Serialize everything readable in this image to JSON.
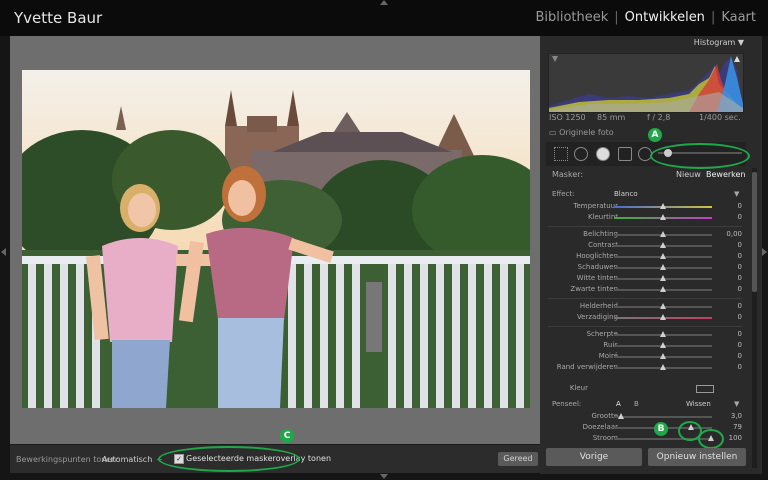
{
  "header": {
    "identity": "Yvette Baur",
    "modules": [
      {
        "label": "Bibliotheek",
        "active": false
      },
      {
        "label": "Ontwikkelen",
        "active": true
      },
      {
        "label": "Kaart",
        "active": false
      }
    ],
    "separator": "|"
  },
  "histogram": {
    "title": "Histogram",
    "iso": "ISO 1250",
    "focal": "85 mm",
    "aperture": "f / 2,8",
    "shutter": "1/400 sec.",
    "original_label": "Originele foto"
  },
  "mask": {
    "label": "Masker:",
    "new_label": "Nieuw",
    "edit_label": "Bewerken"
  },
  "effect": {
    "label": "Effect:",
    "value": "Blanco"
  },
  "adjustments": [
    {
      "label": "Temperatuur",
      "value": "0",
      "pos": 0.5
    },
    {
      "label": "Kleurtint",
      "value": "0",
      "pos": 0.5
    },
    {
      "label": "Belichting",
      "value": "0,00",
      "pos": 0.5
    },
    {
      "label": "Contrast",
      "value": "0",
      "pos": 0.5
    },
    {
      "label": "Hooglichten",
      "value": "0",
      "pos": 0.5
    },
    {
      "label": "Schaduwen",
      "value": "0",
      "pos": 0.5
    },
    {
      "label": "Witte tinten",
      "value": "0",
      "pos": 0.5
    },
    {
      "label": "Zwarte tinten",
      "value": "0",
      "pos": 0.5
    },
    {
      "label": "Helderheid",
      "value": "0",
      "pos": 0.5
    },
    {
      "label": "Verzadiging",
      "value": "0",
      "pos": 0.5
    },
    {
      "label": "Scherpte",
      "value": "0",
      "pos": 0.5
    },
    {
      "label": "Ruis",
      "value": "0",
      "pos": 0.5
    },
    {
      "label": "Moiré",
      "value": "0",
      "pos": 0.5
    },
    {
      "label": "Rand verwijderen",
      "value": "0",
      "pos": 0.5
    }
  ],
  "color_label": "Kleur",
  "brush": {
    "label": "Penseel:",
    "a": "A",
    "b": "B",
    "clear": "Wissen",
    "size_label": "Grootte",
    "size_value": "3,0",
    "feather_label": "Doezelaar",
    "feather_value": "79",
    "flow_label": "Stroom",
    "flow_value": "100"
  },
  "buttons": {
    "previous": "Vorige",
    "reset": "Opnieuw instellen",
    "done": "Gereed"
  },
  "toolbar": {
    "label": "Bewerkingspunten tonen:",
    "value": "Automatisch",
    "spinner": "÷",
    "overlay_label": "Geselecteerde maskeroverlay tonen"
  },
  "annotations": {
    "a": "A",
    "b": "B",
    "c": "C"
  },
  "colors": {
    "annotation": "#1fa84a"
  }
}
